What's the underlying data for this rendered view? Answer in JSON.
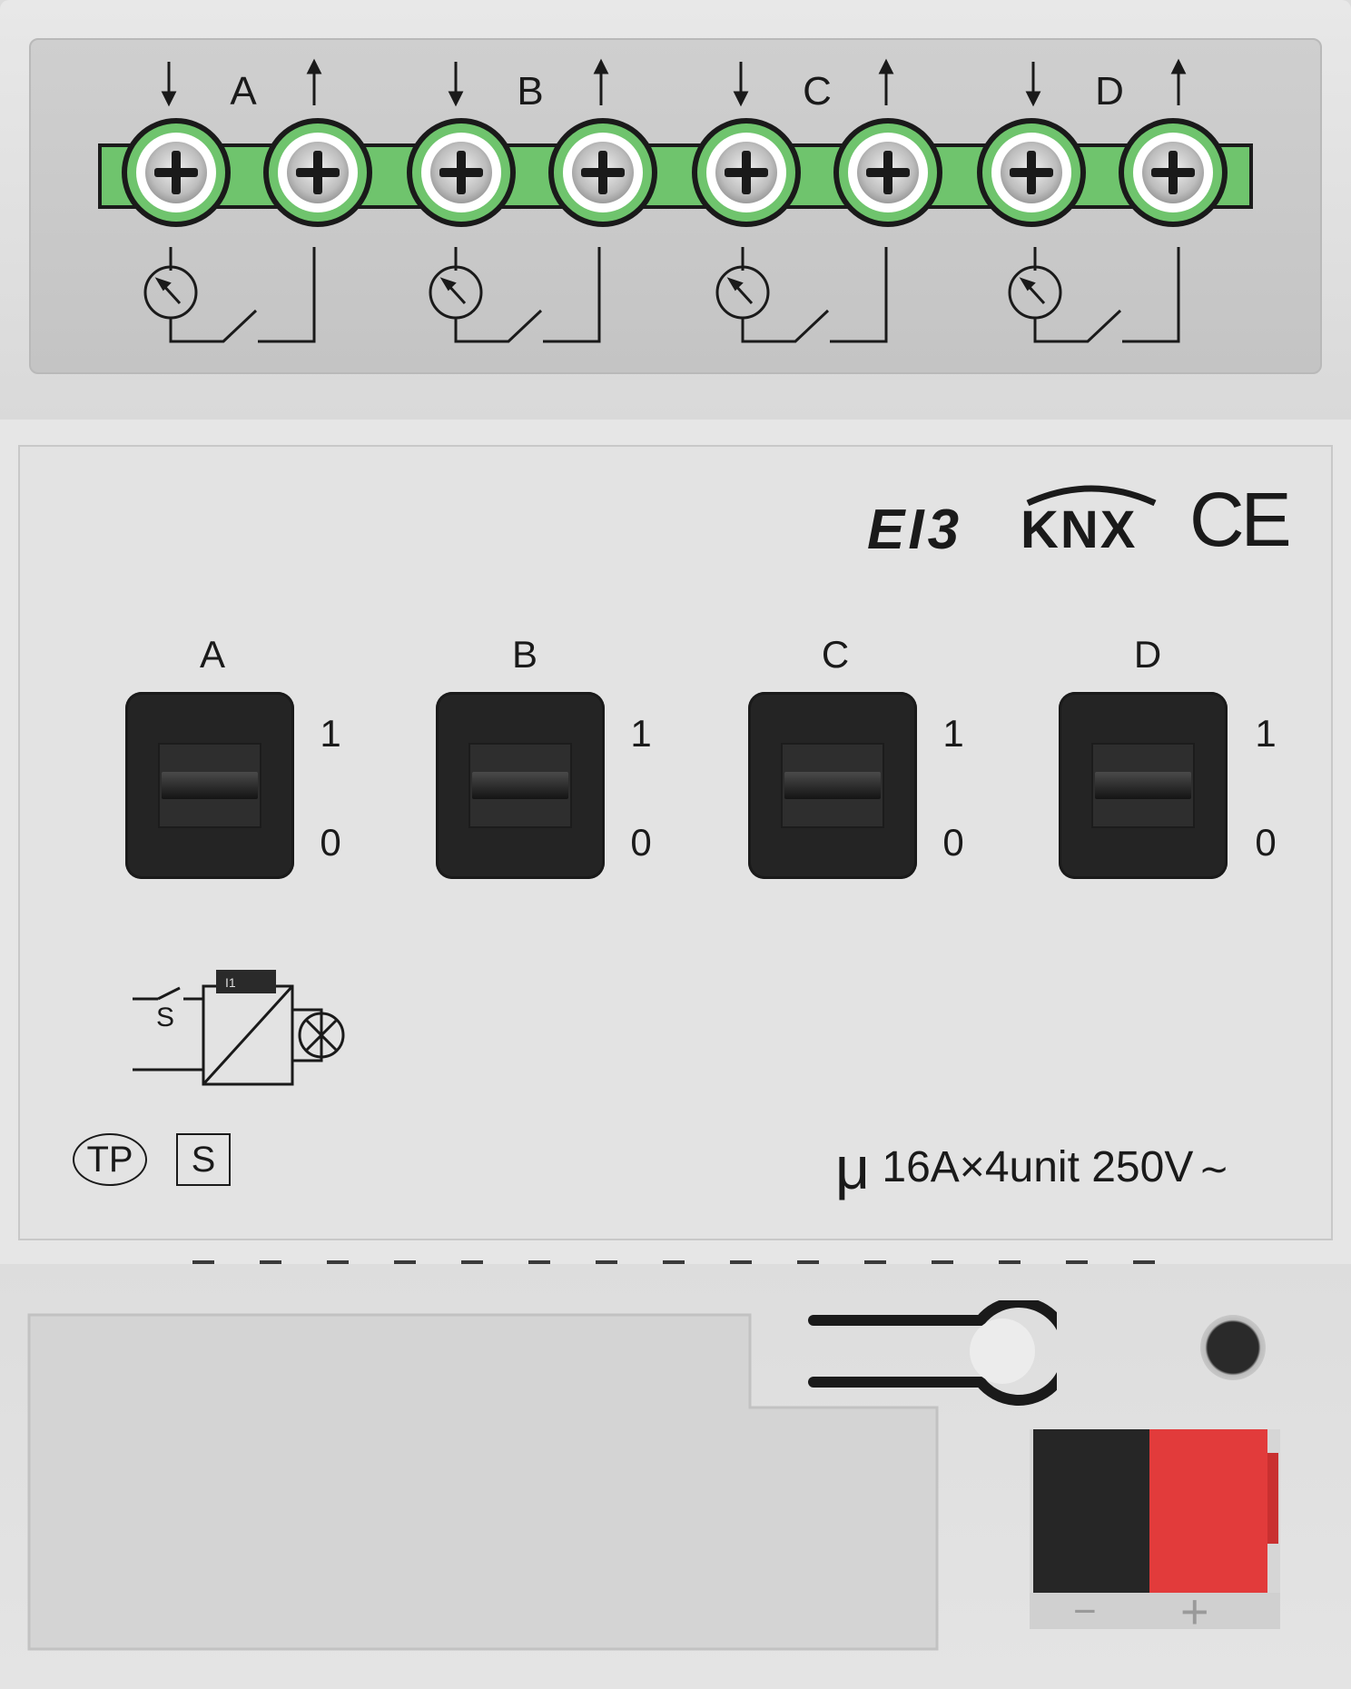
{
  "terminal_block": {
    "channels": [
      "A",
      "B",
      "C",
      "D"
    ]
  },
  "logos": {
    "brand": "EI3",
    "knx": "KNX",
    "ce": "CE"
  },
  "channels": [
    {
      "label": "A",
      "on": "1",
      "off": "0"
    },
    {
      "label": "B",
      "on": "1",
      "off": "0"
    },
    {
      "label": "C",
      "on": "1",
      "off": "0"
    },
    {
      "label": "D",
      "on": "1",
      "off": "0"
    }
  ],
  "diagram": {
    "switch_label": "S",
    "relay_tag": "I1"
  },
  "badges": {
    "tp": "TP",
    "s": "S"
  },
  "rating": {
    "symbol": "μ",
    "text": "16A×4unit 250V",
    "ac_symbol": "∼"
  },
  "bus_connector": {
    "minus": "−",
    "plus": "+"
  },
  "colors": {
    "terminal_green": "#6fc46d",
    "connector_red": "#e23b3b",
    "connector_black": "#262626"
  }
}
